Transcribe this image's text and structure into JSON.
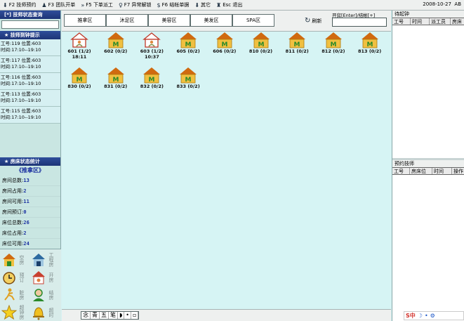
{
  "toolbar": {
    "items": [
      {
        "key": "F2",
        "label": "技师预约",
        "icon": "arrow-down-icon"
      },
      {
        "key": "F3",
        "label": "团队开单",
        "icon": "group-icon"
      },
      {
        "key": "F5",
        "label": "下单派工",
        "icon": "forward-icon"
      },
      {
        "key": "F7",
        "label": "异常解锁",
        "icon": "key-icon"
      },
      {
        "key": "F6",
        "label": "结帐单据",
        "icon": "dollar-icon"
      },
      {
        "key": "",
        "label": "其它",
        "icon": "arrow-down-icon"
      },
      {
        "key": "Esc",
        "label": "退出",
        "icon": "person-exit-icon"
      }
    ],
    "date": "2008-10-27",
    "date_suffix": "AB"
  },
  "left": {
    "search_title": "[*] 技师状态查询",
    "search_placeholder": "",
    "clock_title": "技师到钟提示",
    "techs": [
      {
        "line1": "工号:119  位置:603",
        "line2": "时间:17:10--19:10"
      },
      {
        "line1": "工号:117  位置:603",
        "line2": "时间:17:10--19:10"
      },
      {
        "line1": "工号:116  位置:603",
        "line2": "时间:17:10--19:10"
      },
      {
        "line1": "工号:113  位置:603",
        "line2": "时间:17:10--19:10"
      },
      {
        "line1": "工号:115  位置:603",
        "line2": "时间:17:10--19:10"
      }
    ],
    "room_stat_title": "房床状态统计",
    "area_title": "《推拿区》",
    "stats": [
      {
        "label": "房间总数:",
        "value": "13"
      },
      {
        "label": "房间占用:",
        "value": "2"
      },
      {
        "label": "房间可用:",
        "value": "11"
      },
      {
        "label": "房间预订:",
        "value": "0"
      },
      {
        "label": "床位总数:",
        "value": "26"
      },
      {
        "label": "床位占用:",
        "value": "2"
      },
      {
        "label": "床位可用:",
        "value": "24"
      }
    ],
    "quick": [
      {
        "label": "空房",
        "icon": "house-icon"
      },
      {
        "label": "工程房",
        "icon": "house-blue-icon"
      },
      {
        "label": "预订",
        "icon": "alarm-clock-icon"
      },
      {
        "label": "开房",
        "icon": "house-open-icon"
      },
      {
        "label": "脏房",
        "icon": "running-man-icon"
      },
      {
        "label": "结房",
        "icon": "person-icon"
      },
      {
        "label": "超钟房",
        "icon": "star-icon"
      },
      {
        "label": "超时",
        "icon": "bell-icon"
      }
    ]
  },
  "center": {
    "tabs": [
      "推拿区",
      "沐足区",
      "美容区",
      "美发区",
      "SPA区"
    ],
    "refresh_label": "刷新",
    "open_label": "开房[Enter]/结帐[+]",
    "open_value": "",
    "rooms": [
      {
        "label": "601 (1/2)",
        "time": "18:11",
        "state": "occupied"
      },
      {
        "label": "602 (0/2)",
        "time": "",
        "state": "free"
      },
      {
        "label": "603 (1/2)",
        "time": "10:37",
        "state": "occupied"
      },
      {
        "label": "605 (0/2)",
        "time": "",
        "state": "free"
      },
      {
        "label": "606 (0/2)",
        "time": "",
        "state": "free"
      },
      {
        "label": "810 (0/2)",
        "time": "",
        "state": "free"
      },
      {
        "label": "811 (0/2)",
        "time": "",
        "state": "free"
      },
      {
        "label": "812 (0/2)",
        "time": "",
        "state": "free"
      },
      {
        "label": "813 (0/2)",
        "time": "",
        "state": "free"
      },
      {
        "label": "830 (0/2)",
        "time": "",
        "state": "free"
      },
      {
        "label": "831 (0/2)",
        "time": "",
        "state": "free"
      },
      {
        "label": "832 (0/2)",
        "time": "",
        "state": "free"
      },
      {
        "label": "833 (0/2)",
        "time": "",
        "state": "free"
      }
    ],
    "ime": [
      "念",
      "青",
      "五",
      "笔",
      "◗",
      "•",
      "▫"
    ]
  },
  "right": {
    "wait_title": "待起钟",
    "wait_cols": [
      "工号",
      "时间",
      "派工员",
      "房床"
    ],
    "appoint_title": "预约技师",
    "appoint_cols": [
      "工号",
      "房床位",
      "时间",
      "操作"
    ],
    "sogou": "S中"
  },
  "colors": {
    "title_bar": "#1d3476",
    "stat_value": "#1a2fa0",
    "roof": "#d06a10",
    "wall": "#f0c040",
    "door": "#2a8a2a"
  }
}
